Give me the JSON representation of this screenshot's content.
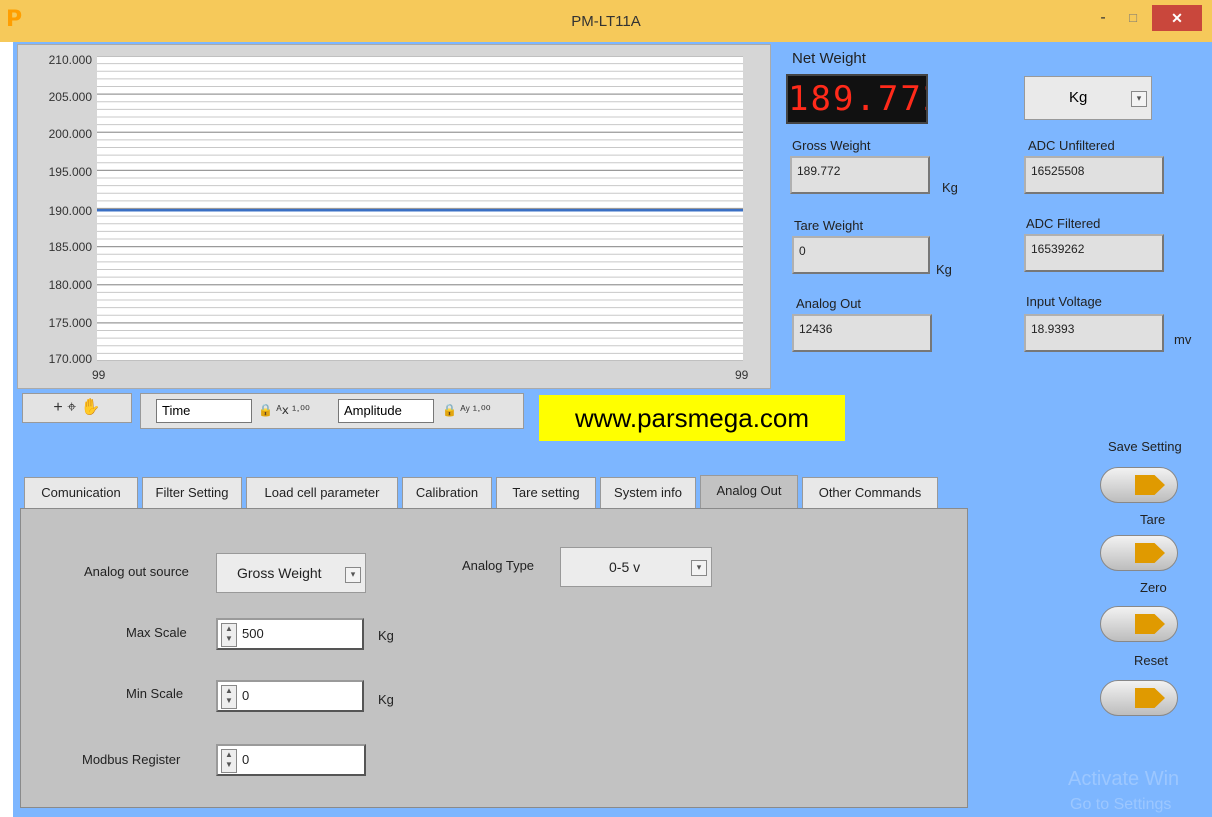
{
  "window": {
    "logo": "P",
    "title": "PM-LT11A",
    "minimize": "-",
    "maximize": "□",
    "close": "✕"
  },
  "graph": {
    "y_ticks": [
      "210.000",
      "205.000",
      "200.000",
      "195.000",
      "190.000",
      "185.000",
      "180.000",
      "175.000",
      "170.000"
    ],
    "x_ticks": [
      "99",
      "99"
    ],
    "ylim": [
      170,
      210
    ],
    "series_value": 189.772,
    "series_color": "#3a6fc4"
  },
  "graph_tools": {
    "tools_label": "+ ⌖ ✋",
    "x_axis_name": "Time",
    "y_axis_name": "Amplitude",
    "x_icons": "🔒 ᴬⅹ ¹·⁰⁰",
    "y_icons": "🔒 ᴬʸ ¹·⁰⁰"
  },
  "website": "www.parsmega.com",
  "readouts": {
    "net_weight_label": "Net Weight",
    "net_weight_value": "189.772",
    "unit_selected": "Kg",
    "gross_weight_label": "Gross Weight",
    "gross_weight_value": "189.772",
    "gross_unit": "Kg",
    "tare_weight_label": "Tare  Weight",
    "tare_weight_value": "0",
    "tare_unit": "Kg",
    "analog_out_label": "Analog Out",
    "analog_out_value": "12436",
    "adc_unfiltered_label": "ADC  Unfiltered",
    "adc_unfiltered_value": "16525508",
    "adc_filtered_label": "ADC Filtered",
    "adc_filtered_value": "16539262",
    "input_voltage_label": "Input Voltage",
    "input_voltage_value": "18.9393",
    "input_voltage_unit": "mv"
  },
  "actions": {
    "save_setting": "Save Setting",
    "tare": "Tare",
    "zero": "Zero",
    "reset": "Reset"
  },
  "tabs": [
    {
      "label": "Comunication"
    },
    {
      "label": "Filter Setting"
    },
    {
      "label": "Load cell parameter"
    },
    {
      "label": "Calibration"
    },
    {
      "label": "Tare setting"
    },
    {
      "label": "System info"
    },
    {
      "label": "Analog Out"
    },
    {
      "label": "Other Commands"
    }
  ],
  "analog_out_tab": {
    "source_label": "Analog out source",
    "source_value": "Gross Weight",
    "type_label": "Analog Type",
    "type_value": "0-5 v",
    "max_scale_label": "Max Scale",
    "max_scale_value": "500",
    "max_scale_unit": "Kg",
    "min_scale_label": "Min Scale",
    "min_scale_value": "0",
    "min_scale_unit": "Kg",
    "modbus_label": "Modbus Register",
    "modbus_value": "0"
  },
  "watermark": {
    "line1": "Activate Win",
    "line2": "Go to Settings"
  }
}
